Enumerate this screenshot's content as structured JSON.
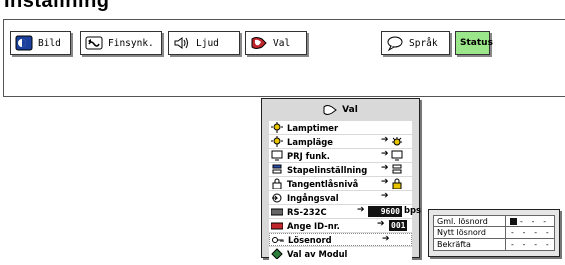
{
  "header": {
    "title": "Inställning"
  },
  "tabs": [
    {
      "label": "Bild",
      "icon": "picture-icon"
    },
    {
      "label": "Finsynk.",
      "icon": "fine-sync-icon"
    },
    {
      "label": "Ljud",
      "icon": "speaker-icon"
    },
    {
      "label": "Val",
      "icon": "options-icon"
    },
    {
      "label": "Språk",
      "icon": "speech-bubble-icon"
    },
    {
      "label": "Status",
      "icon": ""
    }
  ],
  "panel": {
    "title": "Val",
    "items": [
      {
        "label": "Lamptimer",
        "icon": "lamp-timer-icon"
      },
      {
        "label": "Lampläge",
        "icon": "lamp-mode-icon",
        "arrow": "➔"
      },
      {
        "label": "PRJ funk.",
        "icon": "projector-function-icon",
        "arrow": "➔"
      },
      {
        "label": "Stapelinställning",
        "icon": "stack-setting-icon",
        "arrow": "➔"
      },
      {
        "label": "Tangentlåsnivå",
        "icon": "key-lock-icon",
        "arrow": "➔"
      },
      {
        "label": "Ingångsval",
        "icon": "input-select-icon",
        "arrow": "➔"
      },
      {
        "label": "RS-232C",
        "icon": "rs232c-icon",
        "arrow": "➔",
        "value": "9600",
        "unit": "bps"
      },
      {
        "label": "Ange ID-nr.",
        "icon": "id-number-icon",
        "arrow": "➔",
        "value": "001"
      },
      {
        "label": "Lösenord",
        "icon": "password-key-icon",
        "arrow": "➔"
      },
      {
        "label": "Val av Modul",
        "icon": "module-select-icon"
      }
    ]
  },
  "password": {
    "rows": [
      {
        "label": "Gml. lösnord",
        "value": "- - -"
      },
      {
        "label": "Nytt lösnord",
        "value": "- - - -"
      },
      {
        "label": "Bekräfta",
        "value": "- - - -"
      }
    ]
  },
  "colors": {
    "status_green": "#9be58a",
    "panel_bg": "#d9d9d9",
    "accent_red": "#c0262d",
    "accent_blue": "#2a4fb0",
    "accent_yellow": "#e8c400"
  }
}
